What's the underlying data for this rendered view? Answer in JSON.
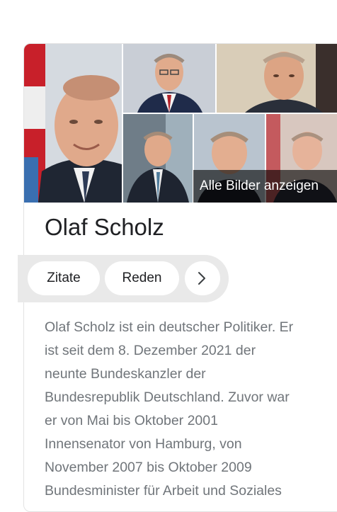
{
  "knowledge_panel": {
    "images": [
      {
        "alt_icon": "portrait-photo-icon"
      },
      {
        "alt_icon": "portrait-photo-icon"
      },
      {
        "alt_icon": "portrait-photo-icon"
      },
      {
        "alt_icon": "portrait-photo-icon"
      },
      {
        "alt_icon": "portrait-photo-icon"
      },
      {
        "alt_icon": "portrait-photo-icon"
      }
    ],
    "more_images_label": "Alle Bilder anzeigen",
    "title": "Olaf Scholz",
    "chips": [
      {
        "label": "Zitate"
      },
      {
        "label": "Reden"
      }
    ],
    "next_chip_icon": "chevron-right-icon",
    "description_lines": [
      "Olaf Scholz ist ein deutscher Politiker. Er",
      "ist seit dem 8. Dezember 2021 der",
      "neunte Bundeskanzler der",
      "Bundesrepublik Deutschland. Zuvor war",
      "er von Mai bis Oktober 2001",
      "Innensenator von Hamburg, von",
      "November 2007 bis Oktober 2009",
      "Bundesminister für Arbeit und Soziales"
    ],
    "colors": {
      "text_primary": "#202124",
      "text_secondary": "#70757a",
      "chip_bar": "#e9e9e9",
      "card_border": "#e3e3e3"
    }
  }
}
